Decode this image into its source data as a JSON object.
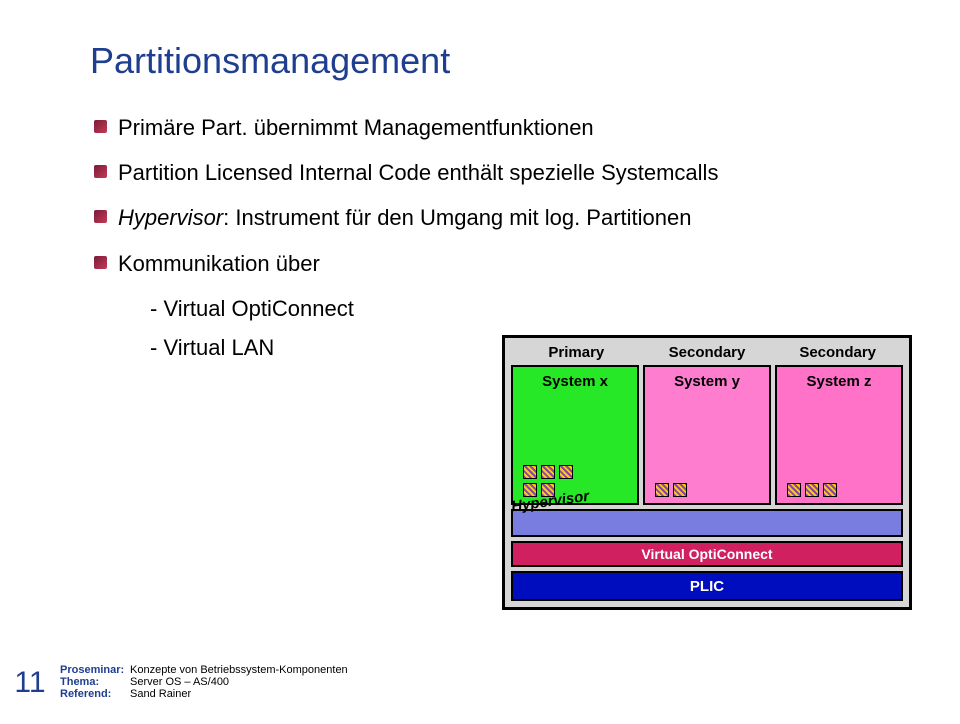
{
  "title": "Partitionsmanagement",
  "bullets": {
    "b1_a": "Primäre Part. ",
    "b1_b": "übernimmt Managementfunktionen",
    "b2_a": "Partition Licensed Internal Code ",
    "b2_b": "enthält spezielle Systemcalls",
    "b3_a": "Hypervisor",
    "b3_b": ": Instrument für den Umgang mit log. Partitionen",
    "b4": "Kommunikation über",
    "sub1": "- Virtual OptiConnect",
    "sub2": "- Virtual LAN"
  },
  "diagram": {
    "hdr1": "Primary",
    "hdr2": "Secondary",
    "hdr3": "Secondary",
    "sys1": "System x",
    "sys2": "System y",
    "sys3": "System z",
    "hypervisor": "Hypervisor",
    "opti": "Virtual OptiConnect",
    "plic": "PLIC"
  },
  "footer": {
    "page": "11",
    "k1": "Proseminar:",
    "v1": "Konzepte von Betriebssystem-Komponenten",
    "k2": "Thema:",
    "v2": "Server OS – AS/400",
    "k3": "Referend:",
    "v3": "Sand Rainer"
  }
}
